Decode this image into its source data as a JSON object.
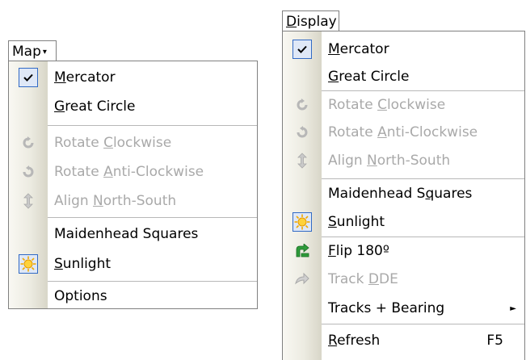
{
  "left_menu": {
    "header_label": "Map",
    "header_arrow": "▾",
    "items": [
      {
        "label": "Mercator",
        "mnemonic": "M",
        "rest": "ercator",
        "checked": true
      },
      {
        "label": "Great Circle",
        "mnemonic": "G",
        "rest": "reat Circle"
      },
      {
        "pre": "Rotate ",
        "mnemonic": "C",
        "rest": "lockwise",
        "label": "Rotate Clockwise",
        "disabled": true,
        "icon": "rotate-clockwise-icon"
      },
      {
        "pre": "Rotate ",
        "mnemonic": "A",
        "rest": "nti-Clockwise",
        "label": "Rotate Anti-Clockwise",
        "disabled": true,
        "icon": "rotate-anticlockwise-icon"
      },
      {
        "pre": "Align ",
        "mnemonic": "N",
        "rest": "orth-South",
        "label": "Align North-South",
        "disabled": true,
        "icon": "align-north-south-icon"
      },
      {
        "label": "Maidenhead Squares"
      },
      {
        "label": "Sunlight",
        "mnemonic": "S",
        "rest": "unlight",
        "icon": "sun-icon",
        "checked": true
      },
      {
        "label": "Options"
      }
    ]
  },
  "right_menu": {
    "header_mnemonic": "D",
    "header_rest": "isplay",
    "items": [
      {
        "label": "Mercator",
        "mnemonic": "M",
        "rest": "ercator",
        "checked": true
      },
      {
        "label": "Great Circle",
        "mnemonic": "G",
        "rest": "reat Circle"
      },
      {
        "label": "Rotate Clockwise",
        "disabled": true,
        "icon": "rotate-clockwise-icon",
        "pre": "Rotate ",
        "mnemonic": "C",
        "rest": "lockwise"
      },
      {
        "label": "Rotate Anti-Clockwise",
        "disabled": true,
        "icon": "rotate-anticlockwise-icon",
        "pre": "Rotate ",
        "mnemonic": "A",
        "rest": "nti-Clockwise"
      },
      {
        "label": "Align North-South",
        "disabled": true,
        "icon": "align-north-south-icon",
        "pre": "Align ",
        "mnemonic": "N",
        "rest": "orth-South"
      },
      {
        "label": "Maidenhead Squares",
        "pre": "Maidenhead S",
        "mnemonic": "q",
        "rest": "uares"
      },
      {
        "label": "Sunlight",
        "mnemonic": "S",
        "rest": "unlight",
        "icon": "sun-icon",
        "checked": true
      },
      {
        "label": "Flip 180º",
        "mnemonic": "F",
        "rest": "lip 180º",
        "icon": "flip-icon"
      },
      {
        "label": "Track DDE",
        "disabled": true,
        "icon": "track-dde-icon",
        "pre": "Track ",
        "mnemonic": "D",
        "rest": "DE"
      },
      {
        "label": "Tracks + Bearing",
        "submenu_arrow": "►"
      },
      {
        "label": "Refresh",
        "mnemonic": "R",
        "rest": "efresh",
        "accel": "F5"
      }
    ]
  },
  "colors": {
    "menu_border": "#808080",
    "disabled_text": "#a9a9a9",
    "check_border": "#316ac5",
    "check_fill": "#dfe8f7",
    "flip_icon": "#2e9b3a",
    "sun_icon": "#f7b500"
  }
}
